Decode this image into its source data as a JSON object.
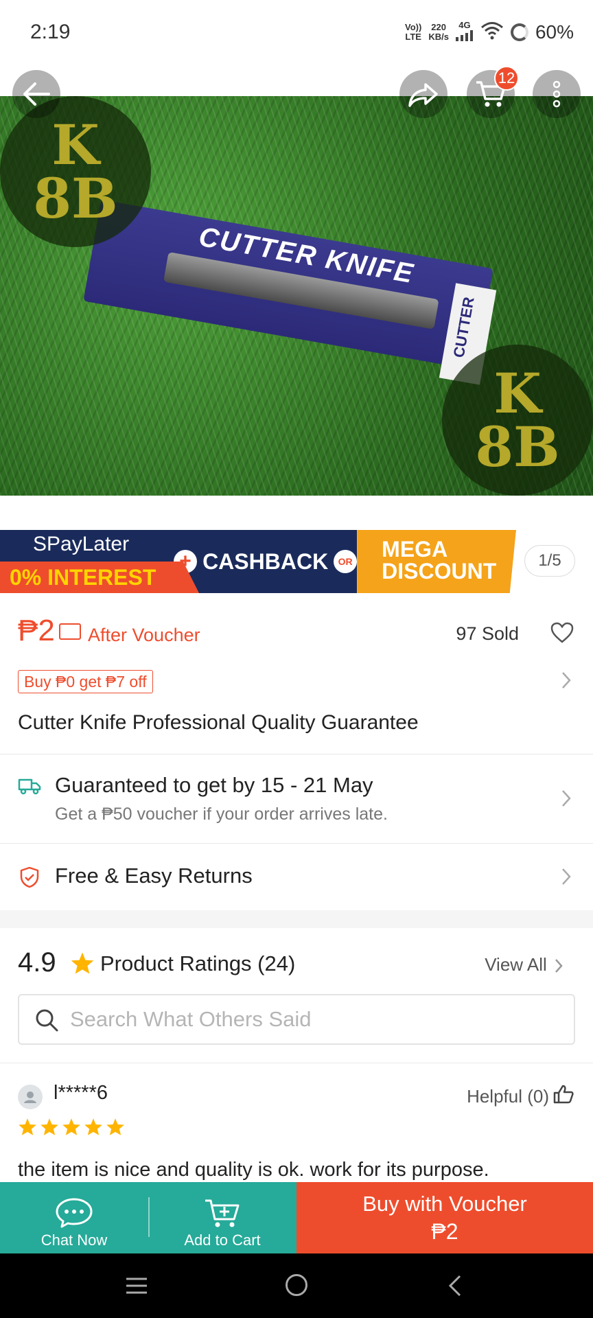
{
  "status_bar": {
    "time": "2:19",
    "volte_top": "Vo))",
    "volte_bottom": "LTE",
    "speed_top": "220",
    "speed_bottom": "KB/s",
    "network": "4G",
    "battery": "60%"
  },
  "hero": {
    "product_text": "CUTTER KNIFE",
    "side_label": "CUTTER",
    "watermark_top": "K",
    "watermark_bottom": "8B",
    "cart_badge": "12"
  },
  "promo_banner": {
    "left_top": "SPayLater",
    "left_bottom": "0% INTEREST",
    "plus": "+",
    "middle": "CASHBACK",
    "or": "OR",
    "right_top": "MEGA",
    "right_bottom": "DISCOUNT",
    "page_indicator": "1/5"
  },
  "price": {
    "value": "₱2",
    "after_voucher": "After Voucher",
    "sold": "97 Sold",
    "promo_tag": "Buy ₱0 get ₱7 off"
  },
  "product": {
    "title": "Cutter Knife Professional Quality Guarantee"
  },
  "shipping": {
    "main": "Guaranteed to get by 15 - 21 May",
    "sub": "Get a ₱50 voucher if your order arrives late."
  },
  "returns": {
    "label": "Free & Easy Returns"
  },
  "ratings": {
    "score": "4.9",
    "label": "Product Ratings (24)",
    "view_all": "View All",
    "search_placeholder": "Search What Others Said"
  },
  "review": {
    "reviewer": "l*****6",
    "helpful": "Helpful (0)",
    "stars": 5,
    "text": "the item is nice and quality is ok. work for its purpose."
  },
  "action_bar": {
    "chat_label": "Chat Now",
    "cart_label": "Add to Cart",
    "buy_label": "Buy with Voucher",
    "buy_price": "₱2"
  },
  "colors": {
    "brand": "#ee4d2d",
    "teal": "#26aa99",
    "star": "#ffb400",
    "banner_navy": "#1a2b5b",
    "banner_orange": "#f5a31a"
  }
}
